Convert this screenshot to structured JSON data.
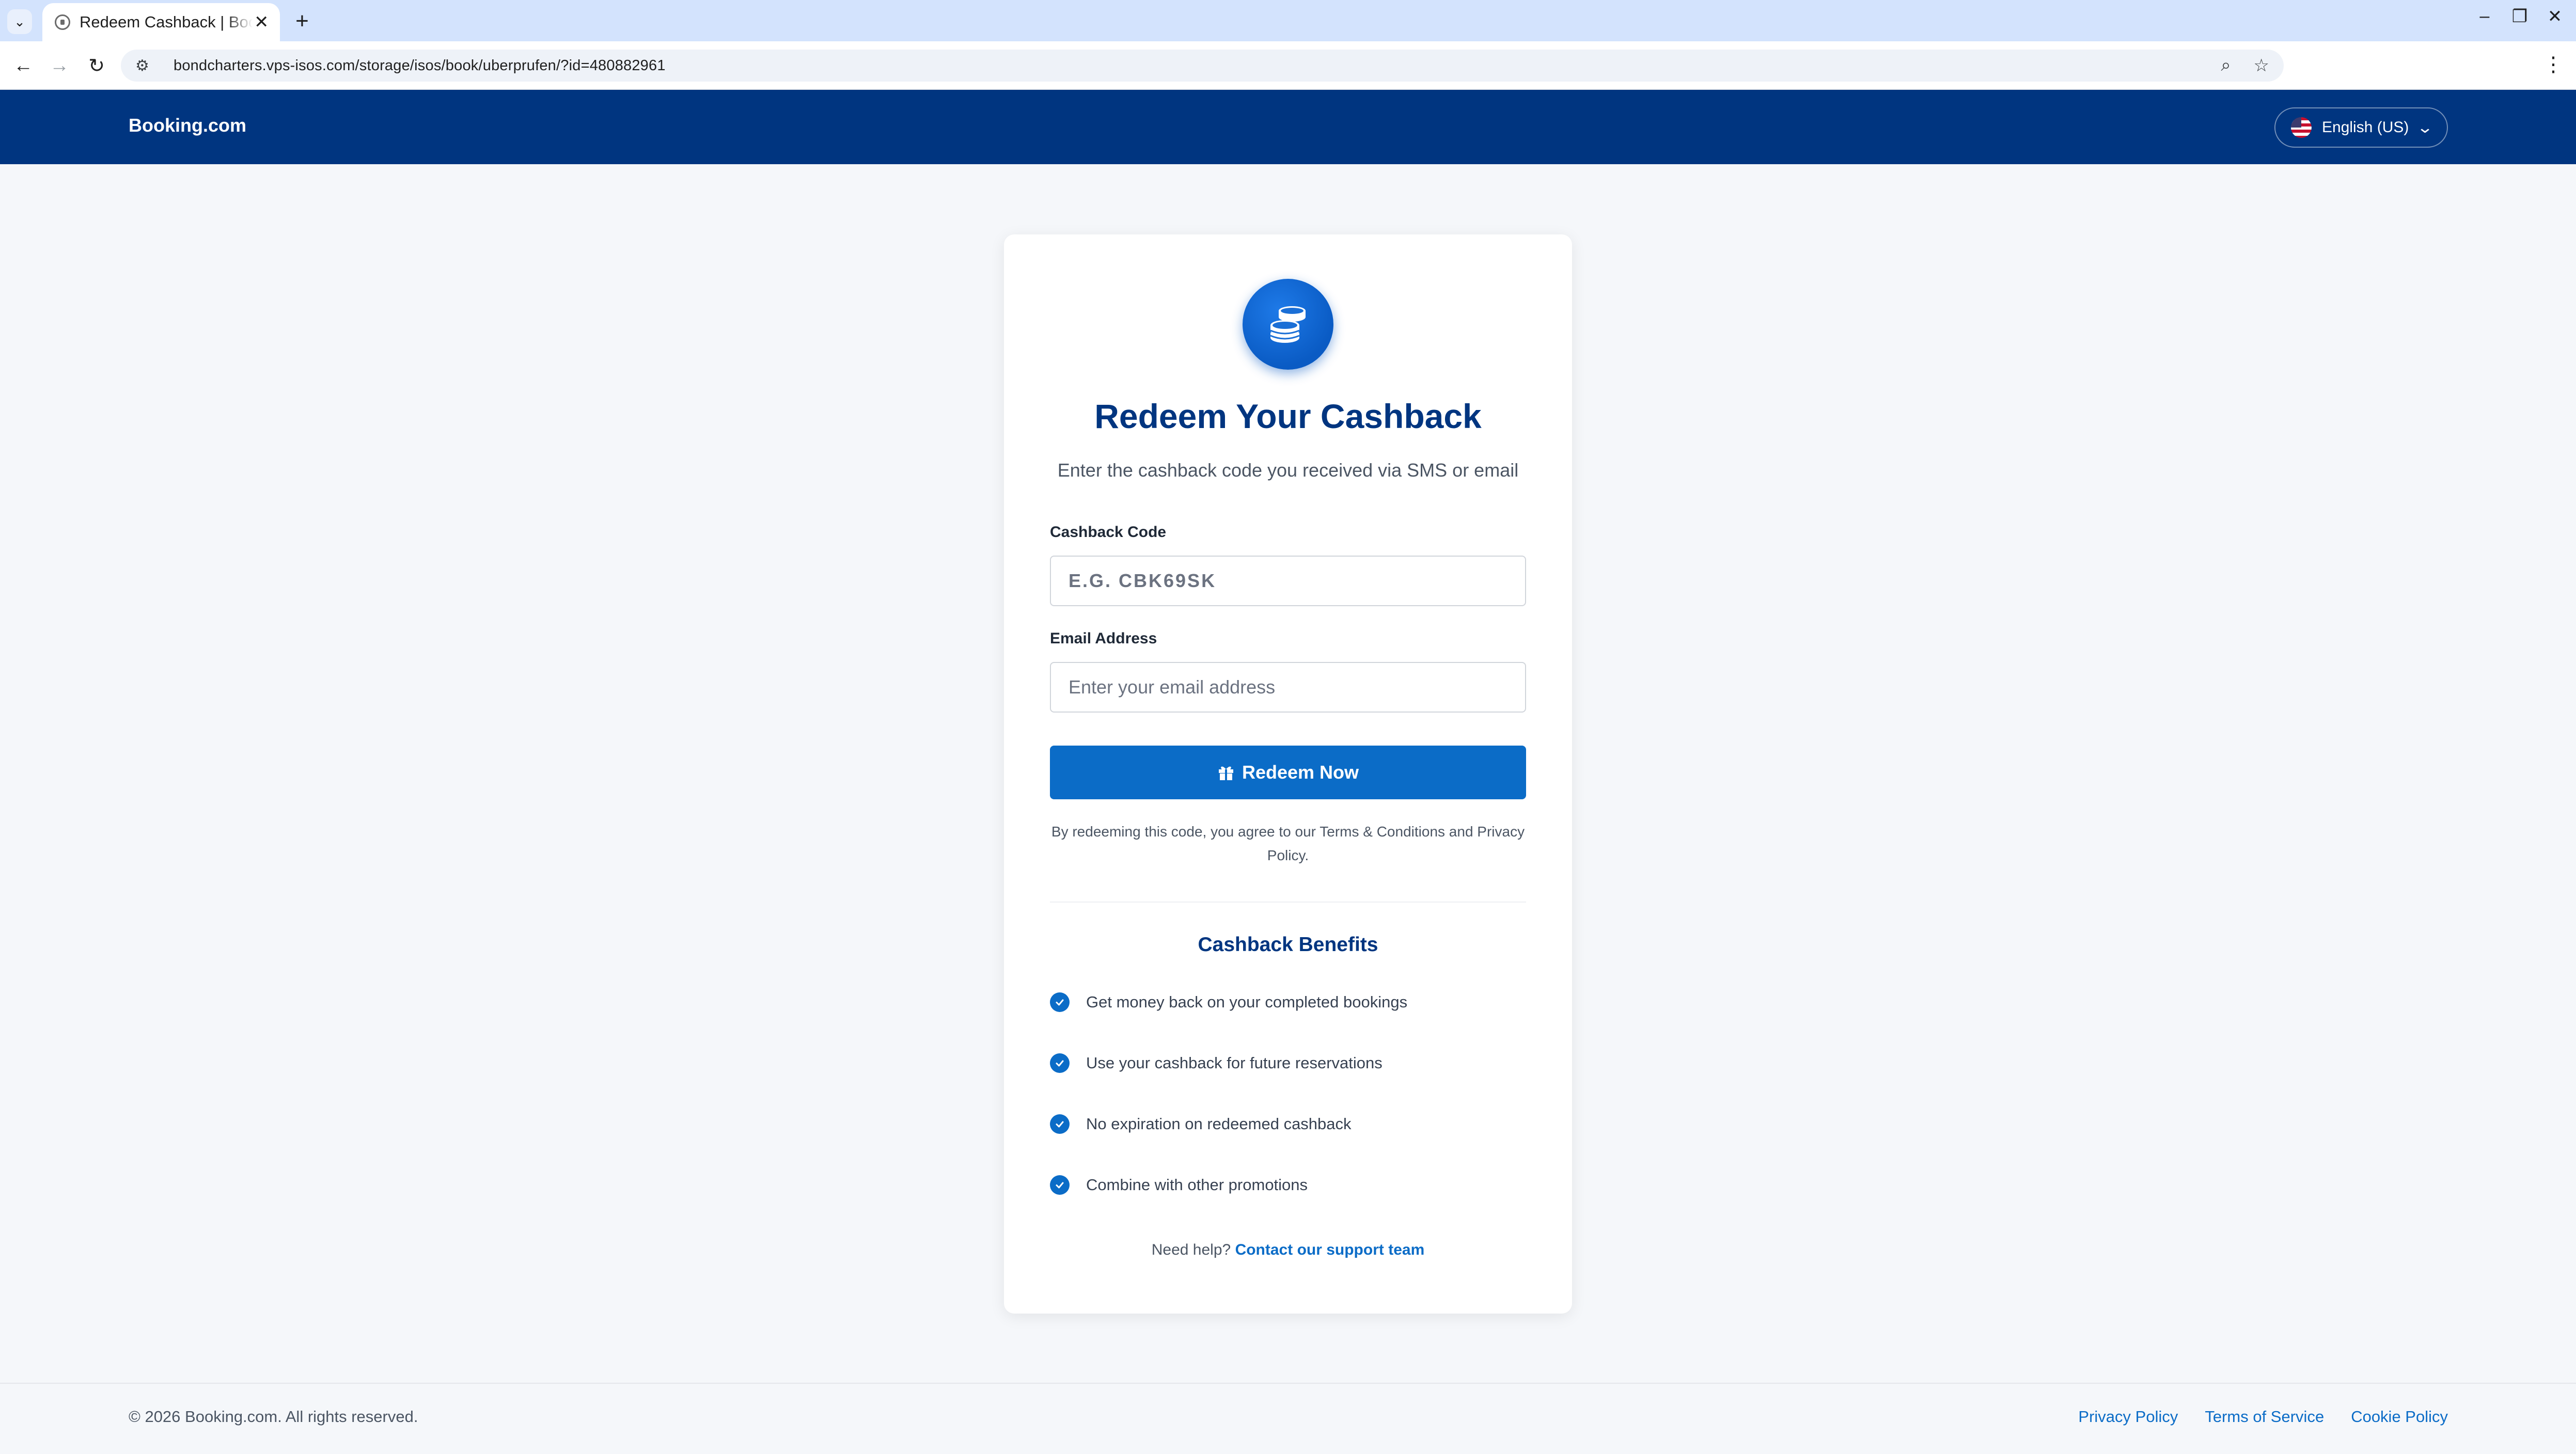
{
  "browser": {
    "tab_title": "Redeem Cashback | Booking.com",
    "tab_close": "✕",
    "new_tab": "+",
    "url": "bondcharters.vps-isos.com/storage/isos/book/uberprufen/?id=480882961",
    "icons": [
      "tab-list-icon",
      "tab-favicon-icon",
      "back-icon",
      "forward-icon",
      "reload-icon",
      "site-info-icon",
      "zoom-icon",
      "bookmark-star-icon",
      "more-menu-icon",
      "minimize-icon",
      "restore-icon",
      "close-window-icon"
    ]
  },
  "header": {
    "brand": "Booking.com",
    "language": "English (US)"
  },
  "card": {
    "title": "Redeem Your Cashback",
    "subtitle": "Enter the cashback code you received via SMS or email",
    "code_label": "Cashback Code",
    "code_placeholder": "E.G. CBK69SK",
    "email_label": "Email Address",
    "email_placeholder": "Enter your email address",
    "redeem_label": "Redeem Now",
    "terms_note": "By redeeming this code, you agree to our Terms & Conditions and Privacy Policy.",
    "benefits_title": "Cashback Benefits",
    "benefits": [
      "Get money back on your completed bookings",
      "Use your cashback for future reservations",
      "No expiration on redeemed cashback",
      "Combine with other promotions"
    ],
    "help_prefix": "Need help?",
    "help_link": "Contact our support team"
  },
  "footer": {
    "copyright": "© 2026 Booking.com. All rights reserved.",
    "links": [
      "Privacy Policy",
      "Terms of Service",
      "Cookie Policy"
    ]
  },
  "colors": {
    "brand_navy": "#003580",
    "accent_blue": "#0b6cc7",
    "chrome_tabstrip": "#d3e3fd",
    "page_bg": "#f5f7fa"
  }
}
